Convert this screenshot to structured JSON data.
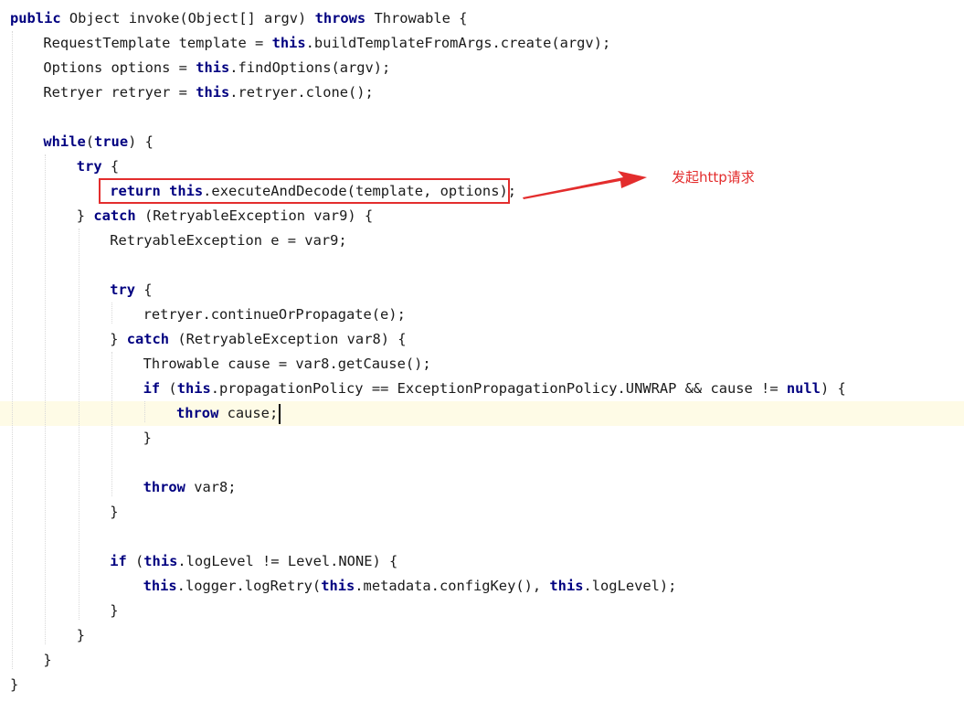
{
  "editor": {
    "current_line": 16,
    "lines": [
      [
        {
          "t": "public",
          "k": 1
        },
        {
          "t": " Object invoke(Object[] argv) "
        },
        {
          "t": "throws",
          "k": 1
        },
        {
          "t": " Throwable {"
        }
      ],
      [
        {
          "t": "RequestTemplate template = "
        },
        {
          "t": "this",
          "k": 1
        },
        {
          "t": ".buildTemplateFromArgs.create(argv);"
        }
      ],
      [
        {
          "t": "Options options = "
        },
        {
          "t": "this",
          "k": 1
        },
        {
          "t": ".findOptions(argv);"
        }
      ],
      [
        {
          "t": "Retryer retryer = "
        },
        {
          "t": "this",
          "k": 1
        },
        {
          "t": ".retryer.clone();"
        }
      ],
      [],
      [
        {
          "t": "while",
          "k": 1
        },
        {
          "t": "("
        },
        {
          "t": "true",
          "k": 1
        },
        {
          "t": ") {"
        }
      ],
      [
        {
          "t": "try",
          "k": 1
        },
        {
          "t": " {"
        }
      ],
      [
        {
          "t": "return",
          "k": 1
        },
        {
          "t": " "
        },
        {
          "t": "this",
          "k": 1
        },
        {
          "t": ".executeAndDecode(template, options);"
        }
      ],
      [
        {
          "t": "} "
        },
        {
          "t": "catch",
          "k": 1
        },
        {
          "t": " (RetryableException var9) {"
        }
      ],
      [
        {
          "t": "RetryableException e = var9;"
        }
      ],
      [],
      [
        {
          "t": "try",
          "k": 1
        },
        {
          "t": " {"
        }
      ],
      [
        {
          "t": "retryer.continueOrPropagate(e);"
        }
      ],
      [
        {
          "t": "} "
        },
        {
          "t": "catch",
          "k": 1
        },
        {
          "t": " (RetryableException var8) {"
        }
      ],
      [
        {
          "t": "Throwable cause = var8.getCause();"
        }
      ],
      [
        {
          "t": "if",
          "k": 1
        },
        {
          "t": " ("
        },
        {
          "t": "this",
          "k": 1
        },
        {
          "t": ".propagationPolicy == ExceptionPropagationPolicy.UNWRAP && cause != "
        },
        {
          "t": "null",
          "k": 1
        },
        {
          "t": ") {"
        }
      ],
      [
        {
          "t": "throw",
          "k": 1
        },
        {
          "t": " cause;"
        }
      ],
      [
        {
          "t": "}"
        }
      ],
      [],
      [
        {
          "t": "throw",
          "k": 1
        },
        {
          "t": " var8;"
        }
      ],
      [
        {
          "t": "}"
        }
      ],
      [],
      [
        {
          "t": "if",
          "k": 1
        },
        {
          "t": " ("
        },
        {
          "t": "this",
          "k": 1
        },
        {
          "t": ".logLevel != Level.NONE) {"
        }
      ],
      [
        {
          "t": "this",
          "k": 1
        },
        {
          "t": ".logger.logRetry("
        },
        {
          "t": "this",
          "k": 1
        },
        {
          "t": ".metadata.configKey(), "
        },
        {
          "t": "this",
          "k": 1
        },
        {
          "t": ".logLevel);"
        }
      ],
      [
        {
          "t": "}"
        }
      ],
      [
        {
          "t": "}"
        }
      ],
      [
        {
          "t": "}"
        }
      ],
      [
        {
          "t": "}"
        }
      ]
    ]
  },
  "annotation": {
    "label": "发起http请求",
    "color": "#e32d2d"
  },
  "colors": {
    "keyword": "#000080",
    "text": "#1a1a1a",
    "current_line_bg": "#fefbe6",
    "background": "#ffffff"
  }
}
